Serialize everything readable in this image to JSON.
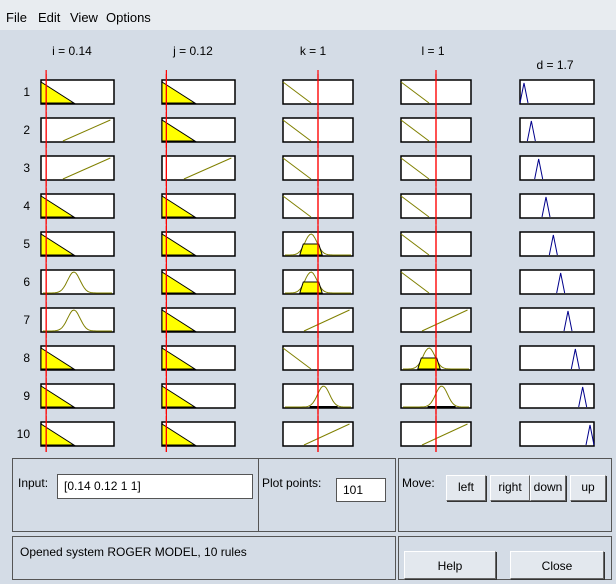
{
  "menu": [
    "File",
    "Edit",
    "View",
    "Options"
  ],
  "inputs": [
    {
      "label": "i = 0.14",
      "value": 0.14
    },
    {
      "label": "j = 0.12",
      "value": 0.12
    },
    {
      "label": "k = 1",
      "value": 1
    },
    {
      "label": "l = 1",
      "value": 1
    }
  ],
  "output": {
    "label": "d = 1.7",
    "value": 1.7
  },
  "rules": [
    "1",
    "2",
    "3",
    "4",
    "5",
    "6",
    "7",
    "8",
    "9",
    "10"
  ],
  "axis": {
    "min": "0",
    "max": "2"
  },
  "controls": {
    "input_label": "Input:",
    "input_value": "[0.14 0.12 1 1]",
    "plot_points_label": "Plot points:",
    "plot_points_value": "101",
    "move_label": "Move:",
    "left": "left",
    "right": "right",
    "down": "down",
    "up": "up",
    "help": "Help",
    "close": "Close"
  },
  "status": "Opened system ROGER MODEL, 10 rules",
  "colors": {
    "fill": "#ffff00",
    "red": "#ff0000",
    "mf": "#808000",
    "out": "#00008b"
  }
}
